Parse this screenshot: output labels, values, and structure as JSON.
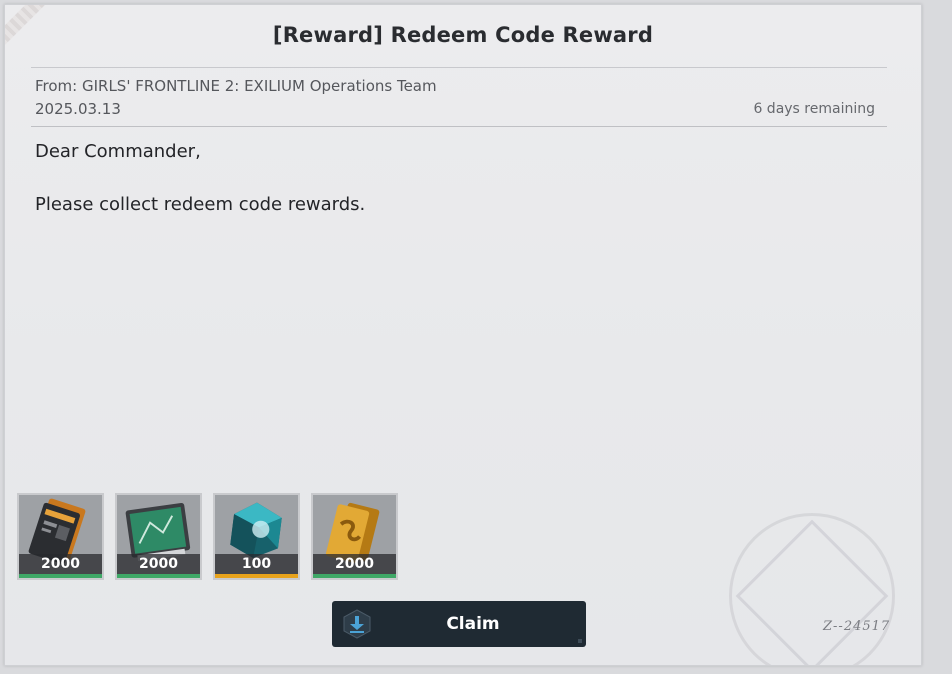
{
  "mail": {
    "title": "[Reward] Redeem Code Reward",
    "from": "From: GIRLS' FRONTLINE 2: EXILIUM Operations Team",
    "date": "2025.03.13",
    "remaining": "6 days remaining",
    "greeting": "Dear Commander,",
    "message": "Please collect redeem code rewards."
  },
  "rewards": [
    {
      "name": "card-ticket",
      "quantity": "2000",
      "rarity_color": "#3fa867"
    },
    {
      "name": "tablet-device",
      "quantity": "2000",
      "rarity_color": "#3fa867"
    },
    {
      "name": "crystal-gem",
      "quantity": "100",
      "rarity_color": "#e8a31c"
    },
    {
      "name": "gold-bars",
      "quantity": "2000",
      "rarity_color": "#3fa867"
    }
  ],
  "claim_button": {
    "label": "Claim",
    "icon": "download-icon",
    "accent": "#4ba3d6"
  },
  "signature": "Z--24517"
}
